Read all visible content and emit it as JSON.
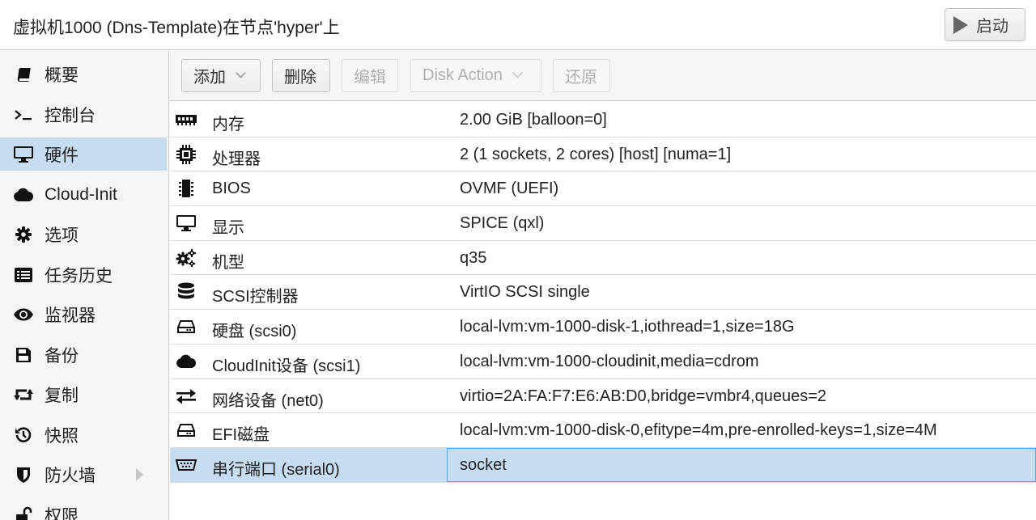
{
  "title": "虚拟机1000 (Dns-Template)在节点'hyper'上",
  "start_button": {
    "label": "启动",
    "icon": "play-icon"
  },
  "sidebar": {
    "items": [
      {
        "label": "概要",
        "icon": "book-icon"
      },
      {
        "label": "控制台",
        "icon": "terminal-icon"
      },
      {
        "label": "硬件",
        "icon": "monitor-icon",
        "active": true
      },
      {
        "label": "Cloud-Init",
        "icon": "cloud-icon"
      },
      {
        "label": "选项",
        "icon": "gear-icon"
      },
      {
        "label": "任务历史",
        "icon": "list-icon"
      },
      {
        "label": "监视器",
        "icon": "eye-icon"
      },
      {
        "label": "备份",
        "icon": "floppy-icon"
      },
      {
        "label": "复制",
        "icon": "retweet-icon"
      },
      {
        "label": "快照",
        "icon": "history-icon"
      },
      {
        "label": "防火墙",
        "icon": "shield-icon",
        "has_submenu": true
      },
      {
        "label": "权限",
        "icon": "unlock-icon"
      }
    ]
  },
  "toolbar": {
    "add_label": "添加",
    "remove_label": "删除",
    "edit_label": "编辑",
    "disk_action_label": "Disk Action",
    "revert_label": "还原"
  },
  "hardware": {
    "rows": [
      {
        "name": "内存",
        "value": "2.00 GiB [balloon=0]",
        "icon": "memory-icon"
      },
      {
        "name": "处理器",
        "value": "2 (1 sockets, 2 cores) [host] [numa=1]",
        "icon": "cpu-icon"
      },
      {
        "name": "BIOS",
        "value": "OVMF (UEFI)",
        "icon": "chip-icon"
      },
      {
        "name": "显示",
        "value": "SPICE (qxl)",
        "icon": "desktop-icon"
      },
      {
        "name": "机型",
        "value": "q35",
        "icon": "cogs-icon"
      },
      {
        "name": "SCSI控制器",
        "value": "VirtIO SCSI single",
        "icon": "database-icon"
      },
      {
        "name": "硬盘 (scsi0)",
        "value": "local-lvm:vm-1000-disk-1,iothread=1,size=18G",
        "icon": "hdd-icon"
      },
      {
        "name": "CloudInit设备 (scsi1)",
        "value": "local-lvm:vm-1000-cloudinit,media=cdrom",
        "icon": "cloud-icon"
      },
      {
        "name": "网络设备 (net0)",
        "value": "virtio=2A:FA:F7:E6:AB:D0,bridge=vmbr4,queues=2",
        "icon": "exchange-icon"
      },
      {
        "name": "EFI磁盘",
        "value": "local-lvm:vm-1000-disk-0,efitype=4m,pre-enrolled-keys=1,size=4M",
        "icon": "hdd-icon"
      },
      {
        "name": "串行端口 (serial0)",
        "value": "socket",
        "icon": "serial-port-icon",
        "selected": true
      }
    ]
  }
}
